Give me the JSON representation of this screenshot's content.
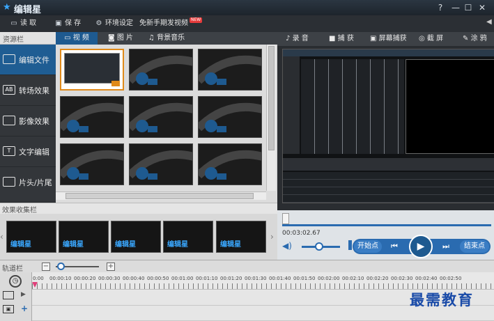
{
  "app": {
    "title": "编辑星"
  },
  "window": {
    "help": "?",
    "minimize": "—",
    "maximize": "☐",
    "close": "✕"
  },
  "toolbar": {
    "items": [
      {
        "icon": "folder-open-icon",
        "label": "读 取"
      },
      {
        "icon": "save-icon",
        "label": "保 存"
      },
      {
        "icon": "gear-icon",
        "label": "环境设定"
      },
      {
        "icon": "",
        "label": "免新手期发视频"
      }
    ],
    "badge": "NEW"
  },
  "sidebar": {
    "title": "资源栏",
    "items": [
      {
        "label": "编辑文件",
        "icon": "edit-file-icon",
        "glyph": ""
      },
      {
        "label": "转场效果",
        "icon": "transition-icon",
        "glyph": "AB"
      },
      {
        "label": "影像效果",
        "icon": "image-effect-icon",
        "glyph": ""
      },
      {
        "label": "文字编辑",
        "icon": "text-edit-icon",
        "glyph": "T"
      },
      {
        "label": "片头/片尾",
        "icon": "intro-outro-icon",
        "glyph": ""
      }
    ]
  },
  "media": {
    "tabs": [
      {
        "label": "视 频"
      },
      {
        "label": "图 片"
      },
      {
        "label": "背景音乐"
      }
    ]
  },
  "effects": {
    "title": "效果收集栏",
    "logo_text": "编辑星"
  },
  "preview_toolbar": {
    "items": [
      {
        "label": "录 音",
        "icon": "microphone-icon"
      },
      {
        "label": "捕 获",
        "icon": "camera-icon"
      },
      {
        "label": "屏幕捕获",
        "icon": "screen-capture-icon"
      },
      {
        "label": "截 屏",
        "icon": "screenshot-icon"
      },
      {
        "label": "涂 鸦",
        "icon": "brush-icon"
      }
    ]
  },
  "player": {
    "time": "00:03:02.67",
    "start_label": "开始点",
    "end_label": "结束点"
  },
  "timeline": {
    "title": "轨道栏",
    "ticks": [
      "0:00",
      "00:00:10",
      "00:00:20",
      "00:00:30",
      "00:00:40",
      "00:00:50",
      "00:01:00",
      "00:01:10",
      "00:01:20",
      "00:01:30",
      "00:01:40",
      "00:01:50",
      "00:02:00",
      "00:02:10",
      "00:02:20",
      "00:02:30",
      "00:02:40",
      "00:02:50"
    ]
  },
  "watermark": "最需教育"
}
